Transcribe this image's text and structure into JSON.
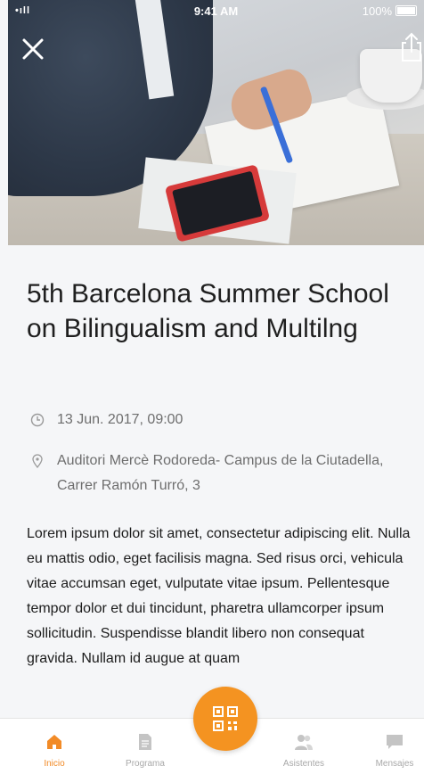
{
  "status_bar": {
    "signal": "•ıll",
    "time": "9:41 AM",
    "battery": "100%"
  },
  "event": {
    "title": "5th Barcelona Summer School on Bilingualism and Multilng",
    "date": "13 Jun. 2017, 09:00",
    "location": "Auditori Mercè Rodoreda- Campus de la Ciutadella, Carrer Ramón Turró, 3",
    "description": "Lorem ipsum dolor sit amet, consectetur adipiscing elit. Nulla eu mattis odio, eget facilisis magna. Sed risus orci, vehicula vitae accumsan eget, vulputate vitae ipsum. Pellentesque tempor dolor et dui tincidunt, pharetra ullamcorper ipsum sollicitudin. Suspendisse blandit libero non consequat gravida. Nullam id augue at quam"
  },
  "tabs": [
    {
      "label": "Inicio",
      "icon": "home-icon",
      "active": true
    },
    {
      "label": "Programa",
      "icon": "document-icon",
      "active": false
    },
    {
      "label": "Asistentes",
      "icon": "people-icon",
      "active": false
    },
    {
      "label": "Mensajes",
      "icon": "chat-icon",
      "active": false
    }
  ],
  "colors": {
    "accent": "#f49321",
    "inactive_tab": "#a8a8a8"
  }
}
